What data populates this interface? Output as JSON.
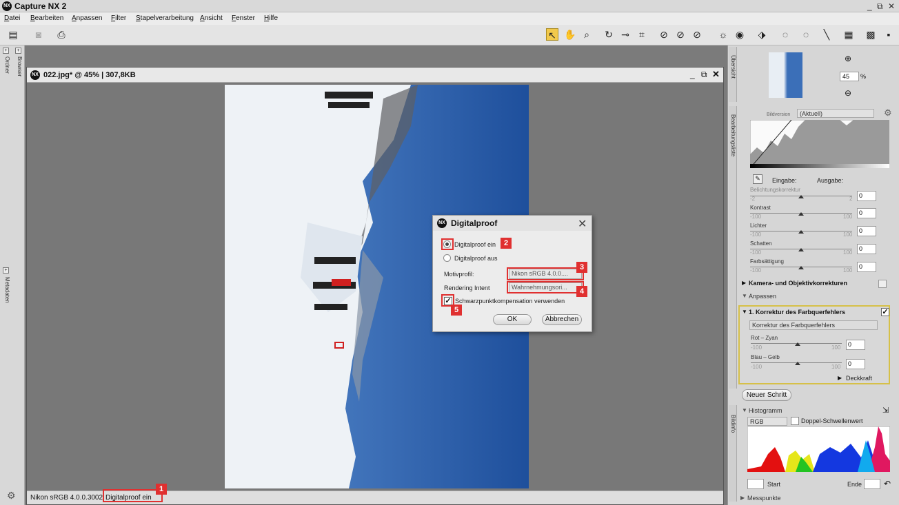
{
  "app": {
    "title": "Capture NX 2"
  },
  "menu": [
    "Datei",
    "Bearbeiten",
    "Anpassen",
    "Filter",
    "Stapelverarbeitung",
    "Ansicht",
    "Fenster",
    "Hilfe"
  ],
  "left_tabs": {
    "ordner": "Ordner",
    "browser": "Browser",
    "metadaten": "Metadaten"
  },
  "document": {
    "title": "022.jpg* @ 45% | 307,8KB",
    "profile": "Nikon sRGB 4.0.0.3002",
    "proof_status": "Digitalproof ein"
  },
  "dialog": {
    "title": "Digitalproof",
    "radio_on": "Digitalproof ein",
    "radio_off": "Digitalproof aus",
    "motivprofil_label": "Motivprofil:",
    "motivprofil_value": "Nikon sRGB 4.0.0....",
    "rendering_label": "Rendering Intent",
    "rendering_value": "Wahrnehmungsori...",
    "checkbox_label": "Schwarzpunktkompensation verwenden",
    "ok": "OK",
    "cancel": "Abbrechen"
  },
  "badges": [
    "1",
    "2",
    "3",
    "4",
    "5"
  ],
  "right": {
    "tab_uebersicht": "Übersicht",
    "zoom": "45",
    "percent": "%",
    "tab_bearbeitung": "Bearbeitungsliste",
    "bildversion_label": "Bildversion",
    "bildversion_value": "(Aktuell)",
    "eingabe": "Eingabe:",
    "ausgabe": "Ausgabe:",
    "belichtung": "Belichtungskorrektur",
    "bel_min": "-2",
    "bel_max": "2",
    "bel_val": "0",
    "kontrast": "Kontrast",
    "lichter": "Lichter",
    "schatten": "Schatten",
    "farbsaettigung": "Farbsättigung",
    "min": "-100",
    "max": "100",
    "zero": "0",
    "kamera": "Kamera- und Objektivkorrekturen",
    "anpassen": "Anpassen",
    "step_title": "1. Korrektur des Farbquerfehlers",
    "step_combo": "Korrektur des Farbquerfehlers",
    "rot_zyan": "Rot – Zyan",
    "blau_gelb": "Blau – Gelb",
    "deckkraft": "Deckkraft",
    "neuer_schritt": "Neuer Schritt",
    "tab_bildinfo": "Bildinfo",
    "histogramm": "Histogramm",
    "hist_channel": "RGB",
    "doppel": "Doppel-Schwellenwert",
    "start": "Start",
    "ende": "Ende",
    "messpunkte": "Messpunkte"
  },
  "colors": {
    "accent_red": "#e03030",
    "highlight_yellow": "#f2c94c"
  }
}
